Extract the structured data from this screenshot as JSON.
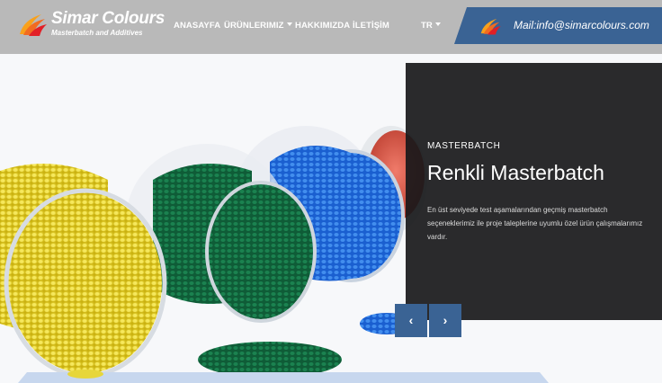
{
  "brand": {
    "name": "Simar Colours",
    "tagline": "Masterbatch and Additives"
  },
  "nav": {
    "items": [
      {
        "label": "ANASAYFA"
      },
      {
        "label": "ÜRÜNLERIMIZ"
      },
      {
        "label": "HAKKIMIZDA"
      },
      {
        "label": "İLETİŞİM"
      }
    ],
    "language": "TR"
  },
  "contact": {
    "mail": "Mail:info@simarcolours.com"
  },
  "slide": {
    "kicker": "MASTERBATCH",
    "title": "Renkli Masterbatch",
    "description": "En üst seviyede test aşamalarından geçmiş masterbatch seçeneklerimiz ile proje taleplerine uyumlu özel ürün çalışmalarımız vardır."
  },
  "controls": {
    "prev": "‹",
    "next": "›"
  },
  "colors": {
    "header_bg": "#b9b9b9",
    "accent": "#3a6394",
    "panel_bg": "#18181a",
    "logo_orange": "#f26b21",
    "logo_red": "#e21f26"
  }
}
